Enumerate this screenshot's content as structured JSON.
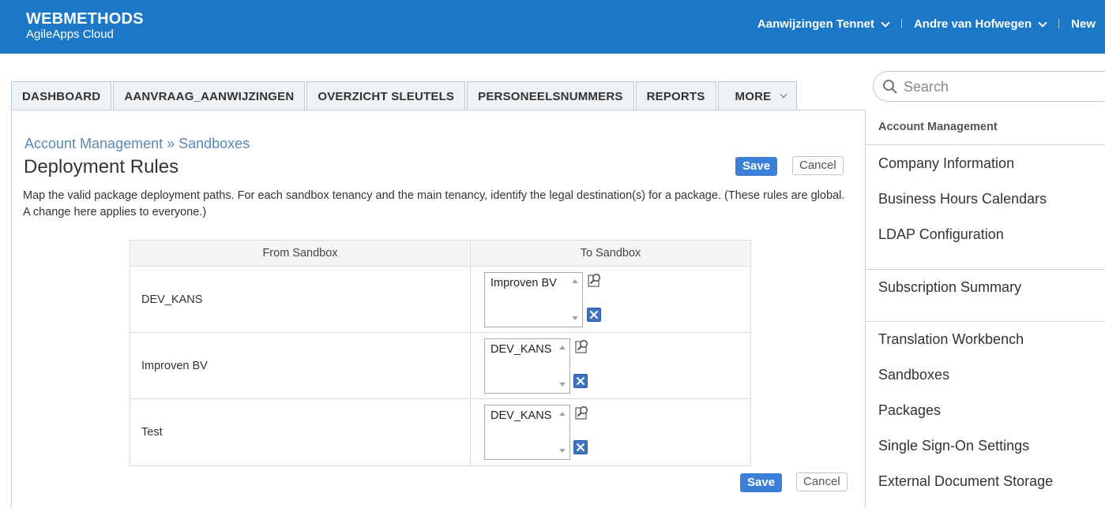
{
  "header": {
    "brand_main": "WEBMETHODS",
    "brand_sub": "AgileApps Cloud",
    "nav": [
      {
        "label": "Aanwijzingen Tennet"
      },
      {
        "label": "Andre van Hofwegen"
      },
      {
        "label": "New"
      }
    ]
  },
  "tabs": [
    "DASHBOARD",
    "AANVRAAG_AANWIJZINGEN",
    "OVERZICHT SLEUTELS",
    "PERSONEELSNUMMERS",
    "REPORTS",
    "MORE"
  ],
  "main": {
    "breadcrumb": "Account Management » Sandboxes",
    "title": "Deployment Rules",
    "save_label": "Save",
    "cancel_label": "Cancel",
    "description": "Map the valid package deployment paths. For each sandbox tenancy and the main tenancy, identify the legal destination(s) for a package. (These rules are global. A change here applies to everyone.)",
    "table": {
      "columns": [
        "From Sandbox",
        "To Sandbox"
      ],
      "rows": [
        {
          "from": "DEV_KANS",
          "to": "Improven BV"
        },
        {
          "from": "Improven BV",
          "to": "DEV_KANS"
        },
        {
          "from": "Test",
          "to": "DEV_KANS"
        }
      ]
    }
  },
  "sidebar": {
    "search_placeholder": "Search",
    "heading": "Account Management",
    "items": [
      "Company Information",
      "Business Hours Calendars",
      "LDAP Configuration",
      "Subscription Summary",
      "Translation Workbench",
      "Sandboxes",
      "Packages",
      "Single Sign-On Settings",
      "External Document Storage"
    ]
  },
  "colors": {
    "header_bg": "#1b78c6",
    "accent": "#3a80d8",
    "link": "#5b87b6"
  }
}
